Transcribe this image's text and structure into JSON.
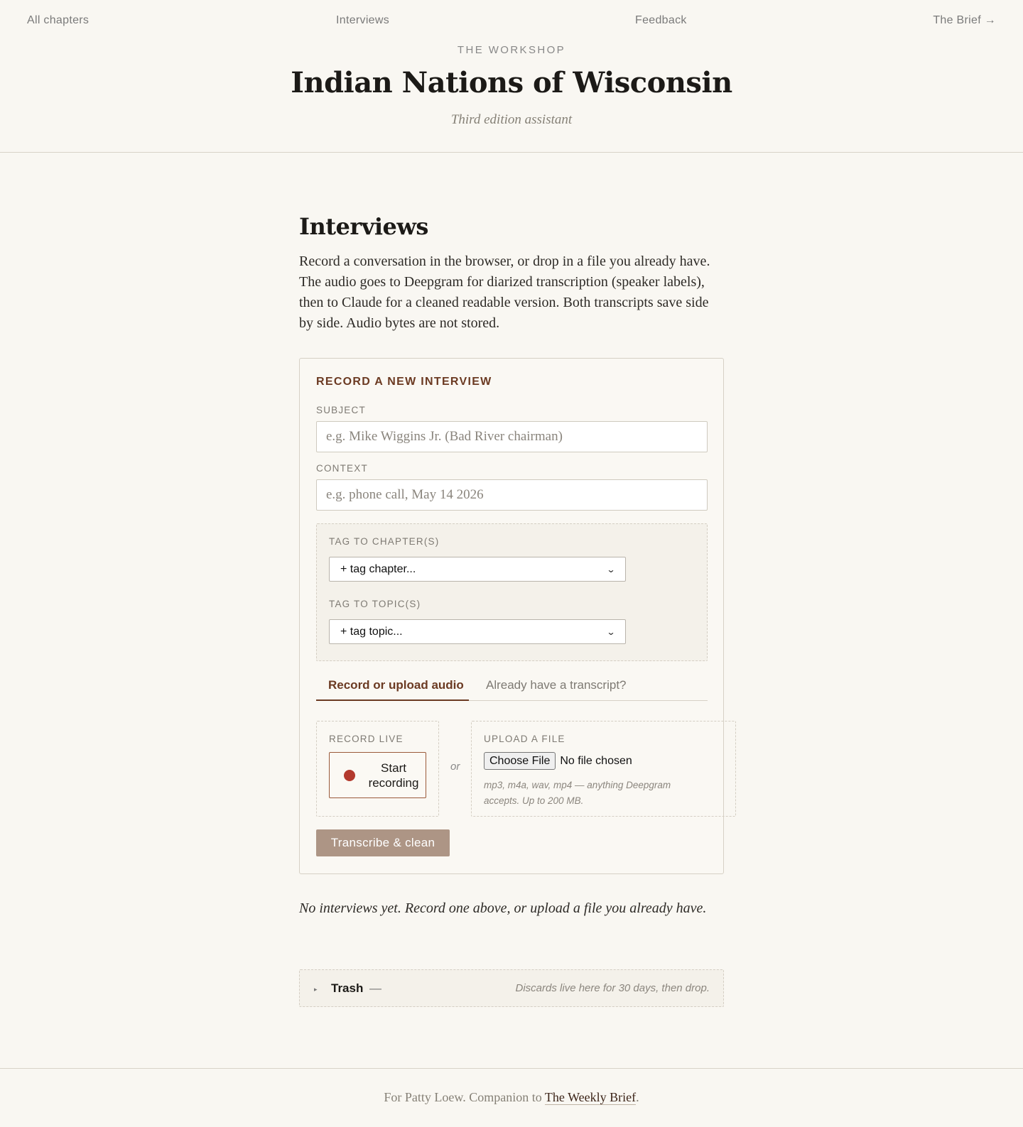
{
  "nav": {
    "all_chapters": "All chapters",
    "interviews": "Interviews",
    "feedback": "Feedback",
    "brief": "The Brief →"
  },
  "header": {
    "eyebrow": "THE WORKSHOP",
    "title": "Indian Nations of Wisconsin",
    "subtitle": "Third edition assistant"
  },
  "page": {
    "title": "Interviews",
    "intro": "Record a conversation in the browser, or drop in a file you already have. The audio goes to Deepgram for diarized transcription (speaker labels), then to Claude for a cleaned readable version. Both transcripts save side by side. Audio bytes are not stored."
  },
  "form": {
    "heading": "RECORD A NEW INTERVIEW",
    "subject_label": "SUBJECT",
    "subject_placeholder": "e.g. Mike Wiggins Jr. (Bad River chairman)",
    "subject_value": "",
    "context_label": "CONTEXT",
    "context_placeholder": "e.g. phone call, May 14 2026",
    "context_value": "",
    "chapters_label": "TAG TO CHAPTER(S)",
    "chapters_select": "+ tag chapter...",
    "topics_label": "TAG TO TOPIC(S)",
    "topics_select": "+ tag topic...",
    "tabs": [
      {
        "label": "Record or upload audio",
        "active": true
      },
      {
        "label": "Already have a transcript?",
        "active": false
      }
    ],
    "record_label": "RECORD LIVE",
    "record_button": "Start recording",
    "or_text": "or",
    "upload_label": "UPLOAD A FILE",
    "choose_file": "Choose File",
    "no_file": "No file chosen",
    "upload_hint": "mp3, m4a, wav, mp4 — anything Deepgram accepts. Up to 200 MB.",
    "submit": "Transcribe & clean"
  },
  "empty_state": "No interviews yet. Record one above, or upload a file you already have.",
  "trash": {
    "title": "Trash",
    "dash": "—",
    "note": "Discards live here for 30 days, then drop."
  },
  "footer": {
    "prefix": "For Patty Loew. Companion to ",
    "link": "The Weekly Brief",
    "suffix": "."
  },
  "colors": {
    "background": "#f9f7f2",
    "accent": "#6b3a22",
    "record_dot": "#b33a2e",
    "submit_button": "#ad9585"
  },
  "icons": {
    "record": "record-dot-icon",
    "select_chevron": "chevron-down-icon",
    "trash_caret": "caret-right-icon"
  }
}
